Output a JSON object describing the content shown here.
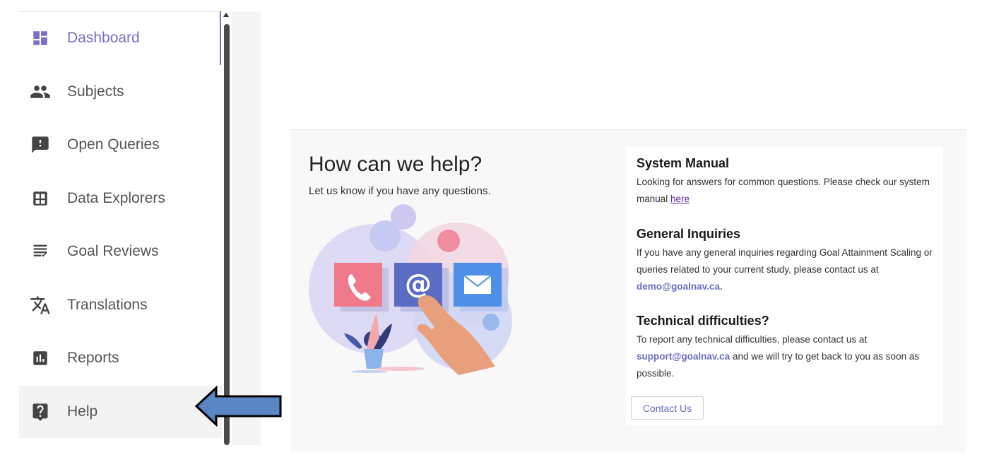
{
  "sidebar": {
    "items": [
      {
        "label": "Dashboard",
        "icon": "dashboard-icon"
      },
      {
        "label": "Subjects",
        "icon": "people-icon"
      },
      {
        "label": "Open Queries",
        "icon": "feedback-icon"
      },
      {
        "label": "Data Explorers",
        "icon": "grid-icon"
      },
      {
        "label": "Goal Reviews",
        "icon": "rule-list-icon"
      },
      {
        "label": "Translations",
        "icon": "translate-icon"
      },
      {
        "label": "Reports",
        "icon": "bar-chart-icon"
      },
      {
        "label": "Help",
        "icon": "help-icon"
      }
    ],
    "selected": "Dashboard",
    "highlighted": "Help"
  },
  "help": {
    "title": "How can we help?",
    "subtitle": "Let us know if you have any questions.",
    "manual": {
      "heading": "System Manual",
      "text": "Looking for answers for common questions. Please check our system manual",
      "link": "here"
    },
    "general": {
      "heading": "General Inquiries",
      "text": "If you have any general inquiries regarding Goal Attainment Scaling or queries related to your current study, please contact us at",
      "email": "demo@goalnav.ca."
    },
    "technical": {
      "heading": "Technical difficulties?",
      "text_before": "To report any technical difficulties, please contact us at",
      "email": "support@goalnav.ca",
      "text_after": "and we will try to get back to you as soon as possible."
    },
    "contact_button": "Contact Us"
  },
  "colors": {
    "accent": "#7b6fc7",
    "arrow_fill": "#5b86c4",
    "email": "#6a6fc0"
  }
}
